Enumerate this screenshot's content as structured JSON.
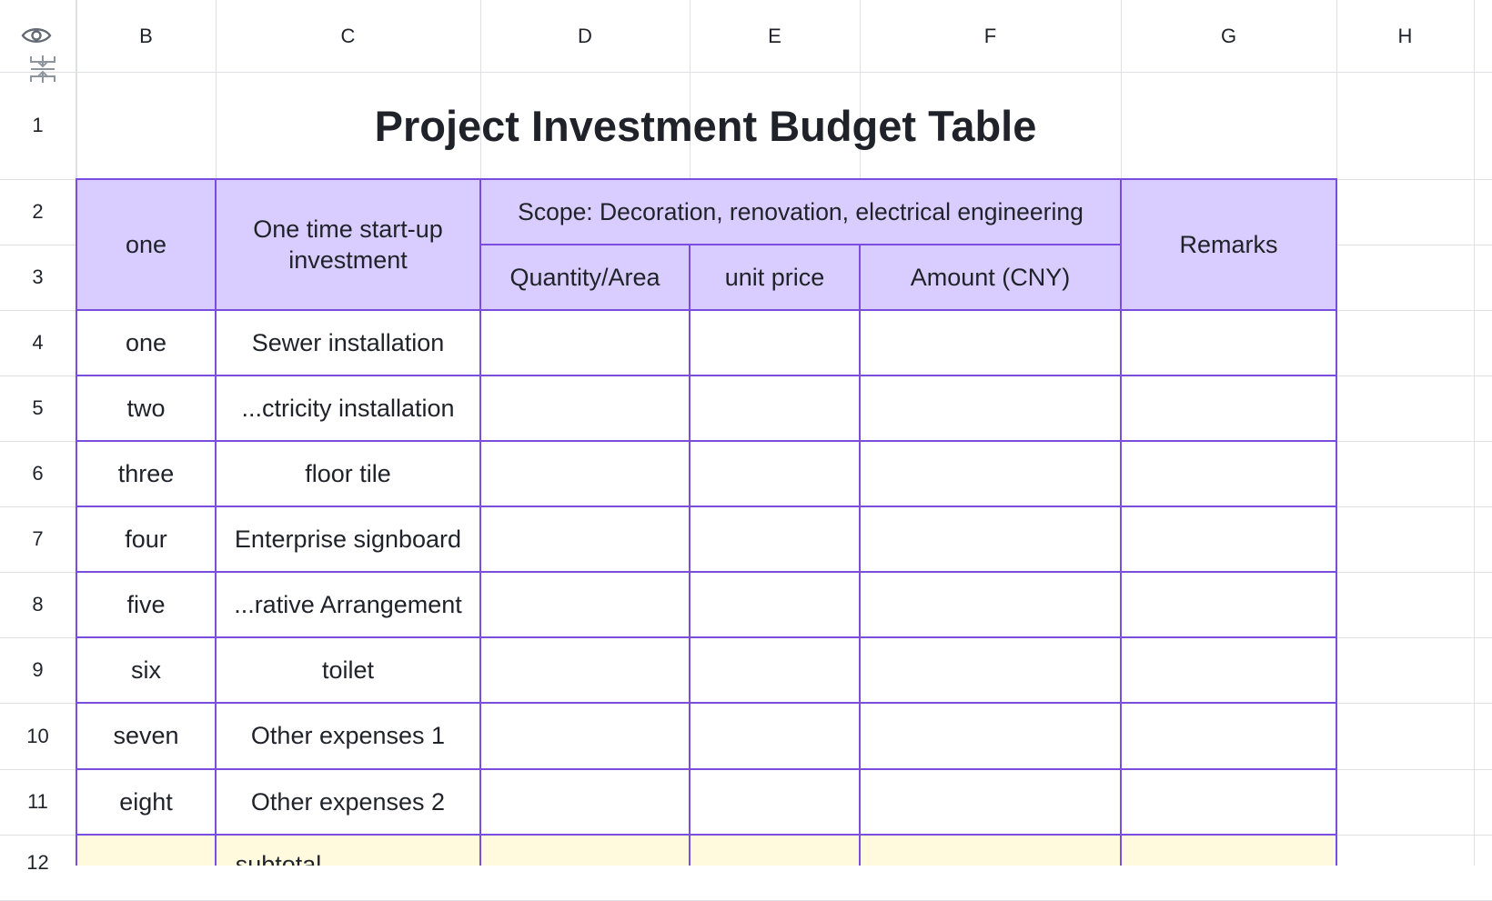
{
  "columns": [
    "B",
    "C",
    "D",
    "E",
    "F",
    "G",
    "H"
  ],
  "rows": [
    "1",
    "2",
    "3",
    "4",
    "5",
    "6",
    "7",
    "8",
    "9",
    "10",
    "11",
    "12"
  ],
  "title": "Project Investment Budget Table",
  "header": {
    "no": "one",
    "item": "One time start-up investment",
    "scope": "Scope: Decoration, renovation, electrical engineering",
    "quantity": "Quantity/Area",
    "unit_price": "unit price",
    "amount": "Amount (CNY)",
    "remarks": "Remarks"
  },
  "items": [
    {
      "no": "one",
      "name": "Sewer installation"
    },
    {
      "no": "two",
      "name": "...ctricity installation"
    },
    {
      "no": "three",
      "name": "floor tile"
    },
    {
      "no": "four",
      "name": "Enterprise signboard"
    },
    {
      "no": "five",
      "name": "...rative Arrangement"
    },
    {
      "no": "six",
      "name": "toilet"
    },
    {
      "no": "seven",
      "name": "Other expenses 1"
    },
    {
      "no": "eight",
      "name": "Other expenses 2"
    }
  ],
  "subtotal_label": "subtotal",
  "icons": {
    "toggle_view": "eye-icon",
    "freeze": "freeze-rows-icon"
  },
  "colors": {
    "header_fill": "#d9ccff",
    "border": "#7a4ce0",
    "subtotal_fill": "#fff9dd",
    "grid": "#dee0e3"
  }
}
